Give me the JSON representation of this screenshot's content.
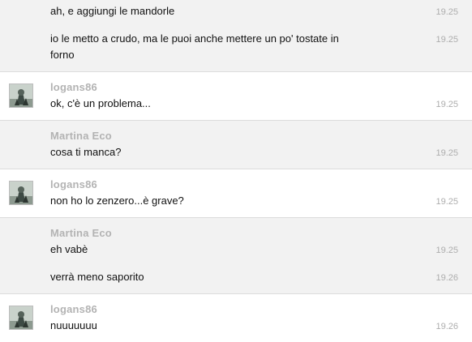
{
  "conversation": {
    "groups": [
      {
        "sender": "",
        "messages": [
          {
            "text": "ah, e aggiungi le mandorle",
            "time": "19.25"
          },
          {
            "text": "io le metto a crudo, ma le puoi anche mettere un po' tostate in forno",
            "time": "19.25"
          }
        ]
      },
      {
        "sender": "logans86",
        "avatar_icon": "user-avatar-icon",
        "messages": [
          {
            "text": "ok, c'è un problema...",
            "time": "19.25"
          }
        ]
      },
      {
        "sender": "Martina Eco",
        "messages": [
          {
            "text": "cosa ti manca?",
            "time": "19.25"
          }
        ]
      },
      {
        "sender": "logans86",
        "avatar_icon": "user-avatar-icon",
        "messages": [
          {
            "text": "non ho lo zenzero...è grave?",
            "time": "19.25"
          }
        ]
      },
      {
        "sender": "Martina Eco",
        "messages": [
          {
            "text": "eh vabè",
            "time": "19.25"
          },
          {
            "text": "verrà meno saporito",
            "time": "19.26"
          }
        ]
      },
      {
        "sender": "logans86",
        "avatar_icon": "user-avatar-icon",
        "messages": [
          {
            "text": "nuuuuuuu",
            "time": "19.26"
          }
        ]
      }
    ]
  },
  "colors": {
    "row_gray": "#f2f2f2",
    "row_white": "#ffffff",
    "sender_text": "#b3b3b3",
    "message_text": "#111111",
    "timestamp_text": "#adadad",
    "divider": "#dcdcdc"
  }
}
